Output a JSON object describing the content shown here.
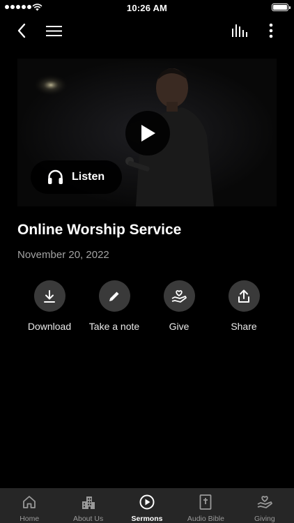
{
  "status_bar": {
    "time": "10:26 AM"
  },
  "header": {
    "back_icon": "chevron-left-icon",
    "menu_icon": "hamburger-icon",
    "audio_icon": "audio-bars-icon",
    "more_icon": "vertical-dots-icon"
  },
  "media": {
    "play_icon": "play-icon",
    "listen_label": "Listen",
    "listen_icon": "headphones-icon"
  },
  "sermon": {
    "title": "Online Worship Service",
    "date": "November 20, 2022"
  },
  "actions": [
    {
      "label": "Download",
      "icon": "download-icon"
    },
    {
      "label": "Take a note",
      "icon": "pencil-icon"
    },
    {
      "label": "Give",
      "icon": "hand-heart-icon"
    },
    {
      "label": "Share",
      "icon": "share-icon"
    }
  ],
  "tabs": [
    {
      "label": "Home",
      "icon": "home-icon",
      "active": false
    },
    {
      "label": "About Us",
      "icon": "building-icon",
      "active": false
    },
    {
      "label": "Sermons",
      "icon": "play-circle-icon",
      "active": true
    },
    {
      "label": "Audio Bible",
      "icon": "bible-icon",
      "active": false
    },
    {
      "label": "Giving",
      "icon": "hand-heart-icon",
      "active": false
    }
  ],
  "colors": {
    "background": "#000000",
    "tab_bar": "#262626",
    "action_circle": "#3a3a3a",
    "date_text": "#a3a3a3",
    "inactive_tab": "#9a9a9a"
  }
}
